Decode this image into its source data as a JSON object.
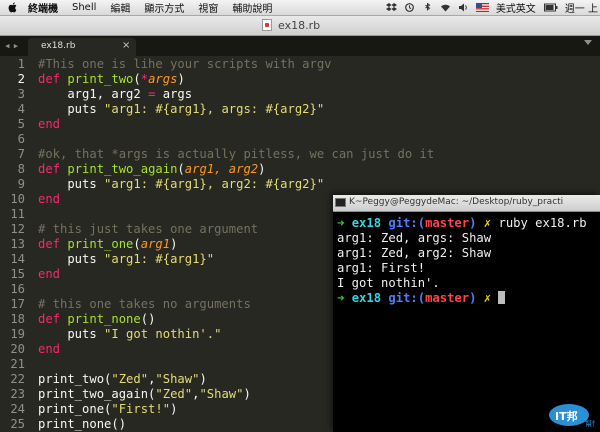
{
  "menubar": {
    "app": "終端機",
    "items": [
      "Shell",
      "編輯",
      "顯示方式",
      "視窗",
      "輔助說明"
    ],
    "input_source": "美式英文",
    "clock": "週一 上"
  },
  "window": {
    "title": "ex18.rb"
  },
  "tab": {
    "name": "ex18.rb",
    "close": "×"
  },
  "editor": {
    "active_line": 2,
    "lines": [
      {
        "n": "1",
        "tokens": [
          {
            "c": "cm",
            "t": "#This one is lihe your scripts with argv"
          }
        ]
      },
      {
        "n": "2",
        "tokens": [
          {
            "c": "kw",
            "t": "def "
          },
          {
            "c": "fn",
            "t": "print_two"
          },
          {
            "c": "",
            "t": "("
          },
          {
            "c": "op",
            "t": "*"
          },
          {
            "c": "pm",
            "t": "args"
          },
          {
            "c": "",
            "t": ")"
          }
        ]
      },
      {
        "n": "3",
        "tokens": [
          {
            "c": "",
            "t": "    arg1, arg2 "
          },
          {
            "c": "op",
            "t": "="
          },
          {
            "c": "",
            "t": " args"
          }
        ]
      },
      {
        "n": "4",
        "tokens": [
          {
            "c": "",
            "t": "    puts "
          },
          {
            "c": "st",
            "t": "\"arg1: #{arg1}, args: #{arg2}\""
          }
        ]
      },
      {
        "n": "5",
        "tokens": [
          {
            "c": "kw",
            "t": "end"
          }
        ]
      },
      {
        "n": "6",
        "tokens": []
      },
      {
        "n": "7",
        "tokens": [
          {
            "c": "cm",
            "t": "#ok, that *args is actually pitless, we can just do it"
          }
        ]
      },
      {
        "n": "8",
        "tokens": [
          {
            "c": "kw",
            "t": "def "
          },
          {
            "c": "fn",
            "t": "print_two_again"
          },
          {
            "c": "",
            "t": "("
          },
          {
            "c": "pm",
            "t": "arg1, arg2"
          },
          {
            "c": "",
            "t": ")"
          }
        ]
      },
      {
        "n": "9",
        "tokens": [
          {
            "c": "",
            "t": "    puts "
          },
          {
            "c": "st",
            "t": "\"arg1: #{arg1}, arg2: #{arg2}\""
          }
        ]
      },
      {
        "n": "10",
        "tokens": [
          {
            "c": "kw",
            "t": "end"
          }
        ]
      },
      {
        "n": "11",
        "tokens": []
      },
      {
        "n": "12",
        "tokens": [
          {
            "c": "cm",
            "t": "# this just takes one argument"
          }
        ]
      },
      {
        "n": "13",
        "tokens": [
          {
            "c": "kw",
            "t": "def "
          },
          {
            "c": "fn",
            "t": "print_one"
          },
          {
            "c": "",
            "t": "("
          },
          {
            "c": "pm",
            "t": "arg1"
          },
          {
            "c": "",
            "t": ")"
          }
        ]
      },
      {
        "n": "14",
        "tokens": [
          {
            "c": "",
            "t": "    puts "
          },
          {
            "c": "st",
            "t": "\"arg1: #{arg1}\""
          }
        ]
      },
      {
        "n": "15",
        "tokens": [
          {
            "c": "kw",
            "t": "end"
          }
        ]
      },
      {
        "n": "16",
        "tokens": []
      },
      {
        "n": "17",
        "tokens": [
          {
            "c": "cm",
            "t": "# this one takes no arguments"
          }
        ]
      },
      {
        "n": "18",
        "tokens": [
          {
            "c": "kw",
            "t": "def "
          },
          {
            "c": "fn",
            "t": "print_none"
          },
          {
            "c": "",
            "t": "()"
          }
        ]
      },
      {
        "n": "19",
        "tokens": [
          {
            "c": "",
            "t": "    puts "
          },
          {
            "c": "st",
            "t": "\"I got nothin'.\""
          }
        ]
      },
      {
        "n": "20",
        "tokens": [
          {
            "c": "kw",
            "t": "end"
          }
        ]
      },
      {
        "n": "21",
        "tokens": []
      },
      {
        "n": "22",
        "tokens": [
          {
            "c": "",
            "t": "print_two("
          },
          {
            "c": "st",
            "t": "\"Zed\""
          },
          {
            "c": "",
            "t": ","
          },
          {
            "c": "st",
            "t": "\"Shaw\""
          },
          {
            "c": "",
            "t": ")"
          }
        ]
      },
      {
        "n": "23",
        "tokens": [
          {
            "c": "",
            "t": "print_two_again("
          },
          {
            "c": "st",
            "t": "\"Zed\""
          },
          {
            "c": "",
            "t": ","
          },
          {
            "c": "st",
            "t": "\"Shaw\""
          },
          {
            "c": "",
            "t": ")"
          }
        ]
      },
      {
        "n": "24",
        "tokens": [
          {
            "c": "",
            "t": "print_one("
          },
          {
            "c": "st",
            "t": "\"First!\""
          },
          {
            "c": "",
            "t": ")"
          }
        ]
      },
      {
        "n": "25",
        "tokens": [
          {
            "c": "",
            "t": "print_none()"
          }
        ]
      }
    ]
  },
  "terminal": {
    "title": "K~Peggy@PeggydeMac: ~/Desktop/ruby_practi",
    "prompt_arrow": "➜",
    "prompt_dir": "ex18",
    "git_label": "git:(",
    "branch": "master",
    "git_close": ")",
    "dirty_mark": "✗",
    "command": "ruby ex18.rb",
    "output": [
      "arg1: Zed, args: Shaw",
      "arg1: Zed, arg2: Shaw",
      "arg1: First!",
      "I got nothin'."
    ]
  },
  "watermark": {
    "text": "IT邦",
    "subtext": "幫忙"
  },
  "colors": {
    "editor_bg": "#272822",
    "comment": "#75715e",
    "keyword": "#f92672",
    "function": "#a6e22e",
    "param": "#fd971f",
    "string": "#e6db74",
    "terminal_bg": "#000000",
    "prompt_arrow": "#2fd22f"
  }
}
